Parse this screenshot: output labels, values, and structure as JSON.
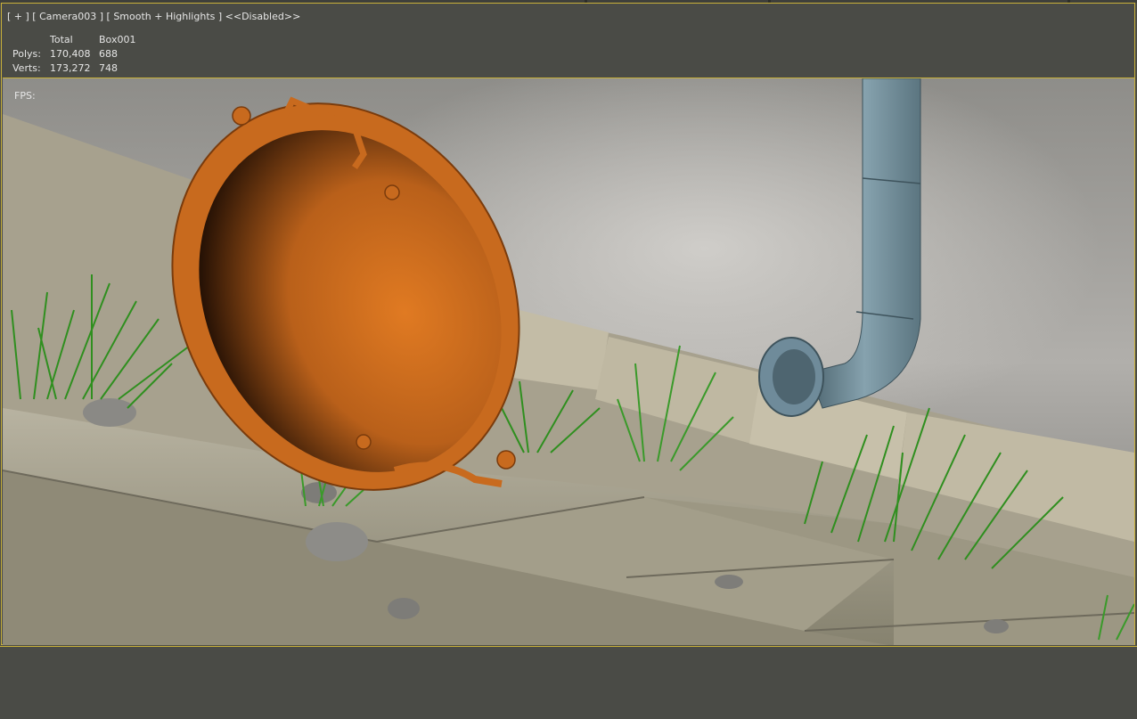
{
  "viewport": {
    "label": "[ + ] [ Camera003 ] [ Smooth + Highlights ] <<Disabled>>",
    "fps_label": "FPS:"
  },
  "stats": {
    "header": [
      "",
      "Total",
      "Box001"
    ],
    "rows": [
      [
        "Polys:",
        "170,408",
        "688"
      ],
      [
        "Verts:",
        "173,272",
        "748"
      ]
    ]
  },
  "colors": {
    "viewport_border": "#c9b13a",
    "pan": "#c86a1e",
    "pipe": "#6f8b9a",
    "grass": "#2f8f1f",
    "ground": "#a9a391"
  }
}
